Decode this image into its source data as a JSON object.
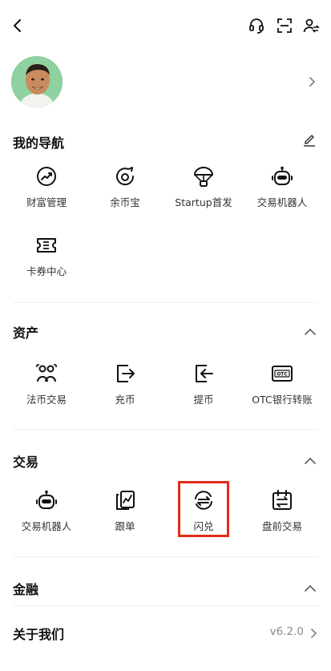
{
  "sections": {
    "nav": {
      "title": "我的导航",
      "items": [
        {
          "label": "财富管理",
          "icon": "wealth-chart-icon"
        },
        {
          "label": "余币宝",
          "icon": "savings-icon"
        },
        {
          "label": "Startup首发",
          "icon": "parachute-icon"
        },
        {
          "label": "交易机器人",
          "icon": "robot-icon"
        },
        {
          "label": "卡券中心",
          "icon": "ticket-icon"
        }
      ]
    },
    "assets": {
      "title": "资产",
      "items": [
        {
          "label": "法币交易",
          "icon": "p2p-users-icon"
        },
        {
          "label": "充币",
          "icon": "deposit-icon"
        },
        {
          "label": "提币",
          "icon": "withdraw-icon"
        },
        {
          "label": "OTC银行转账",
          "icon": "otc-icon"
        }
      ]
    },
    "trade": {
      "title": "交易",
      "items": [
        {
          "label": "交易机器人",
          "icon": "robot-icon"
        },
        {
          "label": "跟单",
          "icon": "copy-trading-icon"
        },
        {
          "label": "闪兑",
          "icon": "convert-icon"
        },
        {
          "label": "盘前交易",
          "icon": "pre-market-icon"
        }
      ]
    },
    "finance": {
      "title": "金融"
    }
  },
  "about": {
    "title": "关于我们",
    "version": "v6.2.0"
  },
  "colors": {
    "highlight": "#e32b1a",
    "text": "#1a1a1a",
    "muted": "#888888"
  }
}
